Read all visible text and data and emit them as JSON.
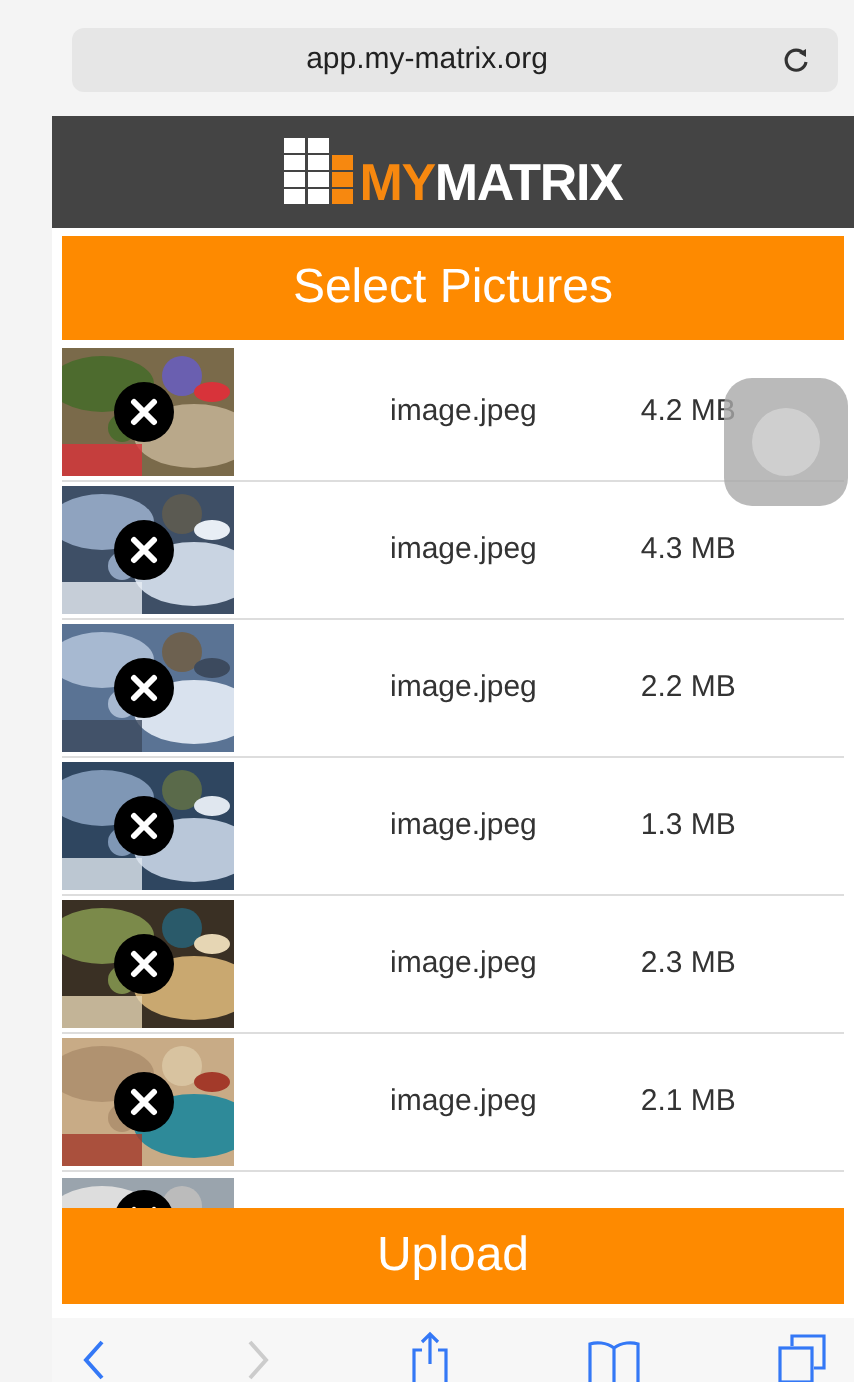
{
  "address_bar": {
    "url": "app.my-matrix.org"
  },
  "header": {
    "logo_accent": "MY",
    "logo_text": "MATRIX"
  },
  "select_button": {
    "label": "Select Pictures"
  },
  "files": [
    {
      "name": "image.jpeg",
      "size": "4.2 MB"
    },
    {
      "name": "image.jpeg",
      "size": "4.3 MB"
    },
    {
      "name": "image.jpeg",
      "size": "2.2 MB"
    },
    {
      "name": "image.jpeg",
      "size": "1.3 MB"
    },
    {
      "name": "image.jpeg",
      "size": "2.3 MB"
    },
    {
      "name": "image.jpeg",
      "size": "2.1 MB"
    },
    {
      "kind": "picture"
    }
  ],
  "upload_button": {
    "label": "Upload"
  },
  "toolbar": {
    "back_disabled": false,
    "forward_disabled": true
  }
}
